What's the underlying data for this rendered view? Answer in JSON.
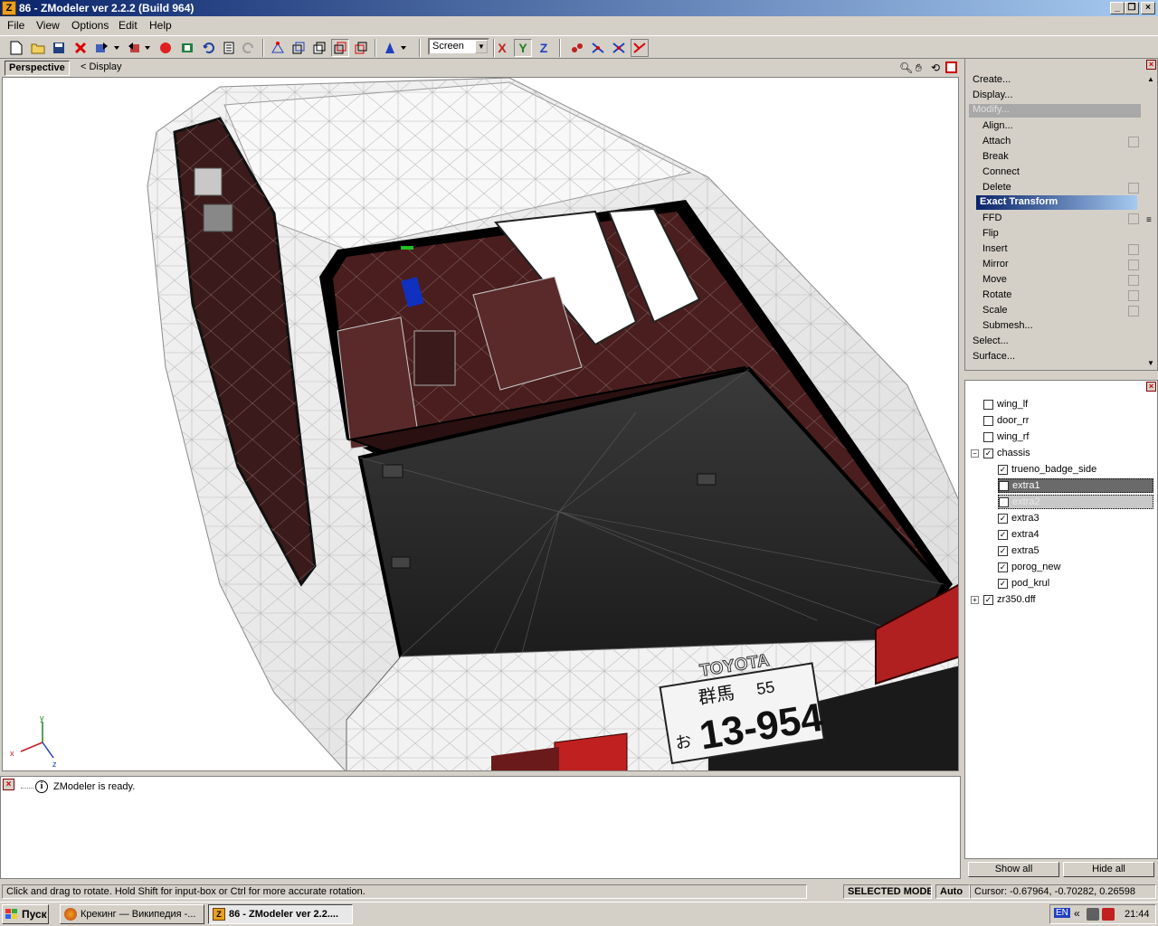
{
  "window": {
    "title": "86 - ZModeler ver 2.2.2 (Build 964)",
    "app_icon": "Z"
  },
  "menu": [
    "File",
    "View",
    "Options",
    "Edit",
    "Help"
  ],
  "toolbar": {
    "screen_value": "Screen",
    "axis_x": "X",
    "axis_y": "Y",
    "axis_z": "Z"
  },
  "viewport": {
    "tab": "Perspective",
    "display_link": "< Display",
    "plate_brand": "TOYOTA",
    "plate_number": "13-954",
    "plate_kana": "お",
    "plate_region": "群馬",
    "plate_code": "55",
    "axes": {
      "x": "x",
      "y": "y",
      "z": "z"
    }
  },
  "commands": {
    "create": "Create...",
    "display": "Display...",
    "modify": "Modify...",
    "items": [
      "Align...",
      "Attach",
      "Break",
      "Connect",
      "Delete",
      "Exact Transform",
      "FFD",
      "Flip",
      "Insert",
      "Mirror",
      "Move",
      "Rotate",
      "Scale",
      "Submesh..."
    ],
    "select": "Select...",
    "surface": "Surface..."
  },
  "tree": [
    {
      "label": "wing_lf",
      "checked": false,
      "level": 0
    },
    {
      "label": "door_rr",
      "checked": false,
      "level": 0
    },
    {
      "label": "wing_rf",
      "checked": false,
      "level": 0
    },
    {
      "label": "chassis",
      "checked": true,
      "level": 0
    },
    {
      "label": "trueno_badge_side",
      "checked": true,
      "level": 1
    },
    {
      "label": "extra1",
      "checked": false,
      "level": 1
    },
    {
      "label": "extra2",
      "checked": true,
      "level": 1
    },
    {
      "label": "extra3",
      "checked": true,
      "level": 1
    },
    {
      "label": "extra4",
      "checked": true,
      "level": 1
    },
    {
      "label": "extra5",
      "checked": true,
      "level": 1
    },
    {
      "label": "porog_new",
      "checked": true,
      "level": 1
    },
    {
      "label": "pod_krul",
      "checked": true,
      "level": 1
    },
    {
      "label": "zr350.dff",
      "checked": true,
      "level": 0
    }
  ],
  "tree_buttons": {
    "show_all": "Show all",
    "hide_all": "Hide all"
  },
  "log": {
    "message": "ZModeler is ready."
  },
  "status": {
    "hint": "Click and drag to rotate. Hold Shift for input-box or Ctrl for more accurate rotation.",
    "mode": "SELECTED MODE",
    "auto": "Auto",
    "cursor": "Cursor: -0.67964, -0.70282, 0.26598"
  },
  "taskbar": {
    "start": "Пуск",
    "task1": "Крекинг — Википедия -...",
    "task2": "86 - ZModeler ver 2.2....",
    "lang": "EN",
    "time": "21:44"
  }
}
